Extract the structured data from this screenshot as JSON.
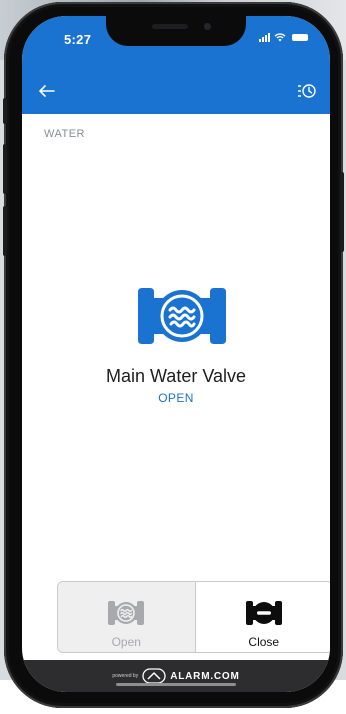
{
  "status_bar": {
    "time": "5:27"
  },
  "section": {
    "label": "WATER"
  },
  "device": {
    "name": "Main Water Valve",
    "status": "OPEN"
  },
  "controls": {
    "open_label": "Open",
    "close_label": "Close"
  },
  "footer": {
    "powered_by": "powered by",
    "brand": "ALARM.COM"
  },
  "icons": {
    "back": "arrow-left-icon",
    "history": "history-list-icon",
    "device": "water-valve-icon",
    "open": "valve-open-icon",
    "close": "valve-closed-icon",
    "brand": "alarm-com-logo-icon"
  },
  "colors": {
    "accent": "#1a73d0",
    "footer": "#2d2d2f",
    "disabled": "#a7a9ac"
  }
}
